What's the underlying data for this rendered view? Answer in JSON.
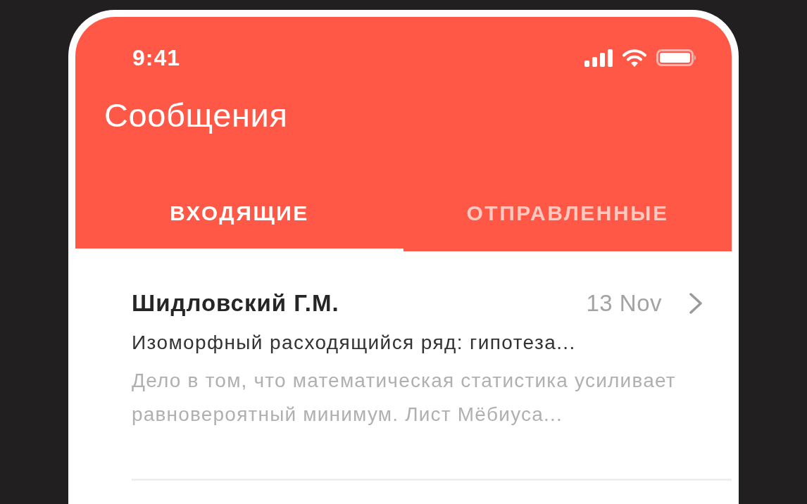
{
  "status_bar": {
    "time": "9:41"
  },
  "header": {
    "title": "Сообщения"
  },
  "tabs": [
    {
      "label": "ВХОДЯЩИЕ",
      "selected": true
    },
    {
      "label": "ОТПРАВЛЕННЫЕ",
      "selected": false
    }
  ],
  "messages": [
    {
      "sender": "Шидловский Г.М.",
      "date": "13 Nov",
      "subject": "Изоморфный расходящийся ряд: гипотеза...",
      "preview": "Дело в том, что математическая статистика усиливает равновероятный минимум. Лист Мёбиуса..."
    }
  ]
}
